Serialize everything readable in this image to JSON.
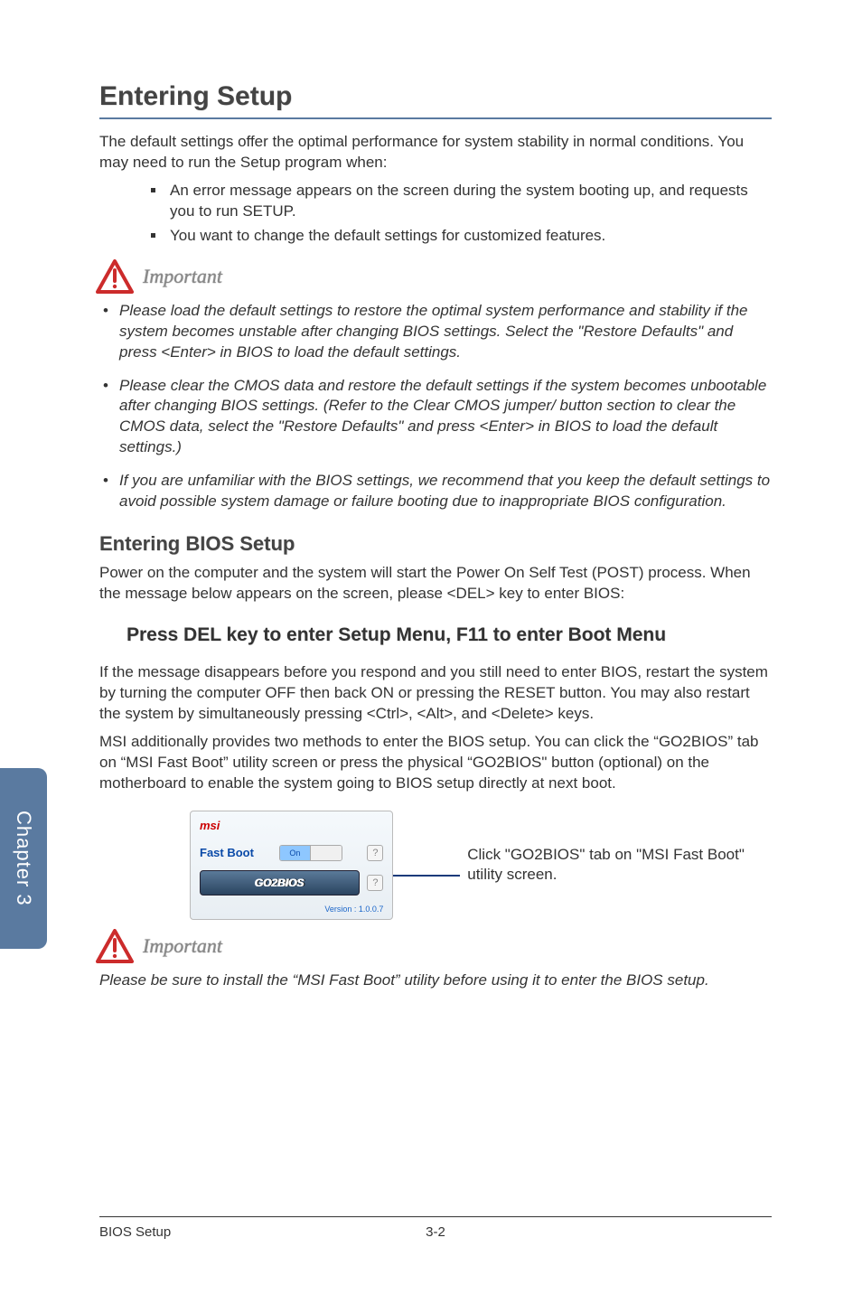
{
  "sideTab": "Chapter 3",
  "heading": "Entering Setup",
  "introPara": "The default settings offer the optimal performance for system stability in normal conditions. You may need to run the Setup program when:",
  "introBullets": [
    "An error message appears on the screen during the system booting up, and requests you to run SETUP.",
    "You want to change the default settings for customized features."
  ],
  "importantLabel": "Important",
  "importantBullets": [
    "Please load the default settings to restore the optimal system performance and stability if the system becomes unstable after changing BIOS settings. Select the \"Restore Defaults\" and press <Enter> in BIOS to load the default settings.",
    "Please clear the CMOS data and restore the default settings if the system becomes unbootable after changing BIOS settings. (Refer to the Clear CMOS jumper/ button section to clear the CMOS data, select the \"Restore Defaults\" and press <Enter> in BIOS to load the default settings.)",
    "If you are unfamiliar with the BIOS settings, we recommend that you keep the default settings to avoid possible system damage or failure booting due to inappropriate BIOS configuration."
  ],
  "subhead": "Entering BIOS Setup",
  "postPara": "Power on the computer and the system will start the Power On Self Test (POST) process. When the message below appears on the screen, please <DEL> key to enter BIOS:",
  "pressLine": "Press DEL key to enter Setup Menu, F11 to enter Boot Menu",
  "afterPress1": "If the message disappears before you respond and you still need to enter BIOS, restart the system by turning the computer OFF then back ON or pressing the RESET button. You may also restart the system by simultaneously pressing <Ctrl>, <Alt>, and <Delete> keys.",
  "afterPress2": "MSI additionally provides two methods to enter the BIOS setup. You can click the “GO2BIOS” tab on “MSI Fast Boot” utility screen or press the physical “GO2BIOS\" button (optional) on the motherboard to enable the system going to BIOS setup directly at next boot.",
  "figure": {
    "brand": "msi",
    "fastBootLabel": "Fast Boot",
    "toggleOn": "On",
    "toggleOff": "",
    "help": "?",
    "go2bios": "GO2BIOS",
    "version": "Version : 1.0.0.7"
  },
  "calloutText": "Click \"GO2BIOS\" tab on \"MSI Fast Boot\" utility screen.",
  "importantLabel2": "Important",
  "finalNote": "Please be sure to install the “MSI Fast Boot” utility before using it to enter the BIOS setup.",
  "footer": {
    "section": "BIOS Setup",
    "page": "3-2"
  }
}
